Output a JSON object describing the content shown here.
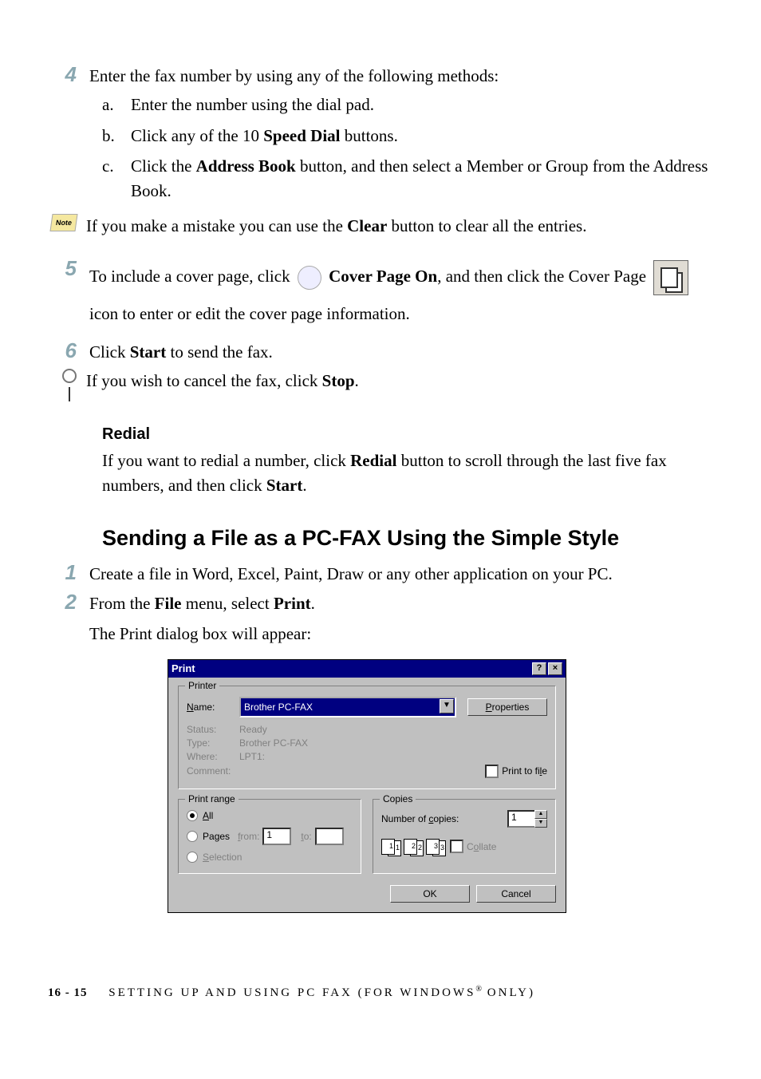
{
  "steps": {
    "s4": {
      "num": "4",
      "intro": "Enter the fax number by using any of the following methods:",
      "a_letter": "a.",
      "a_text": "Enter the number using the dial pad.",
      "b_letter": "b.",
      "b_pre": "Click any of the 10 ",
      "b_bold": "Speed Dial",
      "b_post": " buttons.",
      "c_letter": "c.",
      "c_pre": "Click the ",
      "c_bold": "Address Book",
      "c_post": " button, and then select a Member or Group from the Address Book."
    },
    "note1_pre": "If you make a mistake you can use the ",
    "note1_bold": "Clear",
    "note1_post": " button to clear all the entries.",
    "s5": {
      "num": "5",
      "pre": "To include a cover page, click ",
      "bold1": "Cover Page On",
      "mid1": ",  and then click the Cover Page ",
      "mid2": " icon to enter or edit the cover page information."
    },
    "s6": {
      "num": "6",
      "pre": "Click ",
      "bold": "Start",
      "post": " to send the fax."
    },
    "tip_pre": "If you wish to cancel the fax, click ",
    "tip_bold": "Stop",
    "tip_post": "."
  },
  "redial": {
    "heading": "Redial",
    "p_pre": "If you want to redial a number, click ",
    "p_b1": "Redial",
    "p_mid": " button to scroll through the last five fax numbers, and then click ",
    "p_b2": "Start",
    "p_post": "."
  },
  "section2": {
    "h2": "Sending a File as a PC-FAX Using the Simple Style",
    "s1": {
      "num": "1",
      "text": "Create a file in Word, Excel, Paint, Draw or any other application on your PC."
    },
    "s2": {
      "num": "2",
      "pre": "From the ",
      "b1": "File",
      "mid": " menu, select ",
      "b2": "Print",
      "post": ".",
      "line2": "The Print dialog box will appear:"
    }
  },
  "dialog": {
    "title": "Print",
    "help": "?",
    "close": "×",
    "printer": {
      "legend": "Printer",
      "name_lbl_pre": "N",
      "name_lbl_suf": "ame:",
      "name_value": "Brother PC-FAX",
      "properties_pre": "P",
      "properties_suf": "roperties",
      "status_lbl": "Status:",
      "status_val": "Ready",
      "type_lbl": "Type:",
      "type_val": "Brother PC-FAX",
      "where_lbl": "Where:",
      "where_val": "LPT1:",
      "comment_lbl": "Comment:",
      "print_to_file_pre": "Print to fi",
      "print_to_file_und": "l",
      "print_to_file_suf": "e"
    },
    "range": {
      "legend": "Print range",
      "all_pre": "A",
      "all_suf": "ll",
      "pages_lbl_pre": "Pa",
      "pages_und": "g",
      "pages_suf": "es",
      "from_pre": "f",
      "from_suf": "rom:",
      "from_val": "1",
      "to_pre": "t",
      "to_suf": "o:",
      "to_val": "",
      "selection_pre": "S",
      "selection_suf": "election"
    },
    "copies": {
      "legend": "Copies",
      "num_pre": "Number of ",
      "num_und": "c",
      "num_suf": "opies:",
      "num_val": "1",
      "collate_pre": "C",
      "collate_und": "o",
      "collate_suf": "llate"
    },
    "ok": "OK",
    "cancel": "Cancel"
  },
  "footer": {
    "page_num": "16 - 15",
    "text_pre": "SETTING UP AND USING PC FAX (FOR WINDOWS",
    "reg": "®",
    "text_post": " ONLY)"
  },
  "note_label": "Note"
}
